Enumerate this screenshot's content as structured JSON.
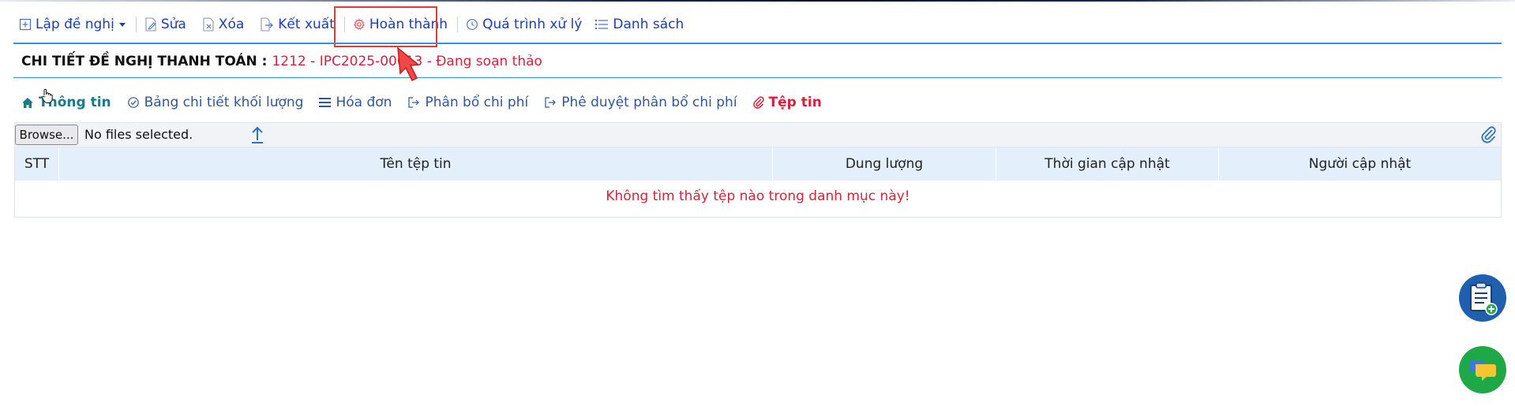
{
  "toolbar": {
    "items": [
      {
        "label": "Lập đề nghị",
        "icon": "plus-square-icon"
      },
      {
        "label": "Sửa",
        "icon": "edit-doc-icon"
      },
      {
        "label": "Xóa",
        "icon": "delete-doc-icon"
      },
      {
        "label": "Kết xuất",
        "icon": "export-icon"
      },
      {
        "label": "Hoàn thành",
        "icon": "gear-icon"
      },
      {
        "label": "Quá trình xử lý",
        "icon": "history-icon"
      },
      {
        "label": "Danh sách",
        "icon": "list-icon"
      }
    ]
  },
  "title": {
    "label": "CHI TIẾT ĐỀ NGHỊ THANH TOÁN :",
    "value": "1212 - IPC2025-00013 - Đang soạn thảo"
  },
  "tabs": [
    {
      "label": "Thông tin",
      "icon": "home-icon"
    },
    {
      "label": "Bảng chi tiết khối lượng",
      "icon": "check-circle-icon"
    },
    {
      "label": "Hóa đơn",
      "icon": "bars-icon"
    },
    {
      "label": "Phân bổ chi phí",
      "icon": "sign-out-icon"
    },
    {
      "label": "Phê duyệt phân bổ chi phí",
      "icon": "sign-out-icon"
    },
    {
      "label": "Tệp tin",
      "icon": "paperclip-icon"
    }
  ],
  "upload": {
    "browse_label": "Browse...",
    "status": "No files selected."
  },
  "table": {
    "headers": [
      "STT",
      "Tên tệp tin",
      "Dung lượng",
      "Thời gian cập nhật",
      "Người cập nhật"
    ],
    "empty_message": "Không tìm thấy tệp nào trong danh mục này!"
  },
  "colors": {
    "toolbar_text": "#1a3fb5",
    "accent_red": "#d8223a",
    "divider_blue": "#3d8fd6",
    "header_bg": "#e3effb",
    "fab_doc": "#1f5fae",
    "fab_chat": "#1fa847"
  }
}
